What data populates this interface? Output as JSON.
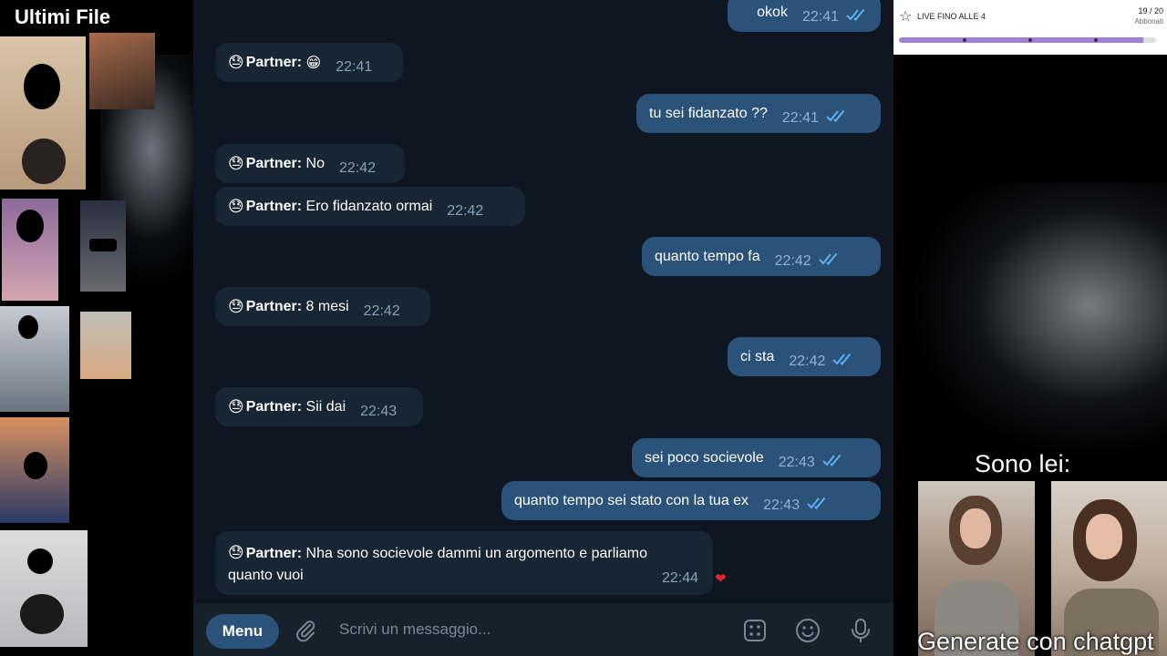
{
  "left_panel": {
    "title": "Ultimi File"
  },
  "chat": {
    "messages": [
      {
        "dir": "out",
        "text": "okok",
        "time": "22:41"
      },
      {
        "dir": "in",
        "sender": "Partner:",
        "text": "😁",
        "time": "22:41"
      },
      {
        "dir": "out",
        "text": "tu sei fidanzato ??",
        "time": "22:41"
      },
      {
        "dir": "in",
        "sender": "Partner:",
        "text": "No",
        "time": "22:42"
      },
      {
        "dir": "in",
        "sender": "Partner:",
        "text": "Ero fidanzato ormai",
        "time": "22:42"
      },
      {
        "dir": "out",
        "text": "quanto tempo fa",
        "time": "22:42"
      },
      {
        "dir": "in",
        "sender": "Partner:",
        "text": "8 mesi",
        "time": "22:42"
      },
      {
        "dir": "out",
        "text": "ci sta",
        "time": "22:42"
      },
      {
        "dir": "in",
        "sender": "Partner:",
        "text": "Sii dai",
        "time": "22:43"
      },
      {
        "dir": "out",
        "text": "sei poco socievole",
        "time": "22:43"
      },
      {
        "dir": "out",
        "text": "quanto tempo sei stato con la tua ex",
        "time": "22:43"
      },
      {
        "dir": "in",
        "sender": "Partner:",
        "text": "Nha sono socievole dammi un argomento e parliamo",
        "text2": "quanto vuoi",
        "time": "22:44",
        "reaction": "❤"
      }
    ],
    "sender_emoji": "😓"
  },
  "input_bar": {
    "menu_label": "Menu",
    "placeholder": "Scrivi un messaggio...",
    "icons": [
      "attach-icon",
      "keyboard-grid-icon",
      "emoji-icon",
      "microphone-icon"
    ]
  },
  "right_panel": {
    "live": {
      "title": "LIVE FINO ALLE 4",
      "count": "19 / 20",
      "subtitle": "Abbonati",
      "progress": 0.95
    },
    "caption_top": "Sono lei:",
    "caption_bottom": "Generate con chatgpt"
  },
  "colors": {
    "chat_bg": "#0e1621",
    "incoming_bubble": "#182533",
    "outgoing_bubble": "#2b5278",
    "check": "#5fb0ef",
    "progress_fill": "#a07fd8"
  }
}
